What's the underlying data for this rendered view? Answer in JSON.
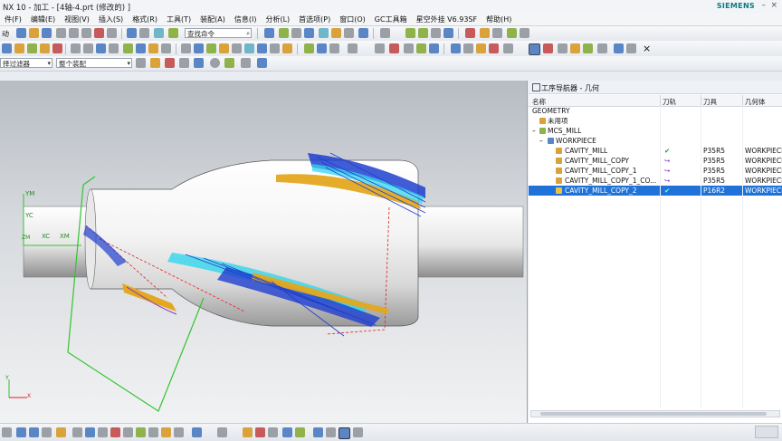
{
  "window": {
    "title": "NX 10 - 加工 - [4轴-4.prt  (修改的)  ]",
    "brand": "SIEMENS"
  },
  "menu": [
    "件(F)",
    "编辑(E)",
    "视图(V)",
    "插入(S)",
    "格式(R)",
    "工具(T)",
    "装配(A)",
    "信息(I)",
    "分析(L)",
    "首选项(P)",
    "窗口(O)",
    "GC工具箱",
    "星空外挂 V6.93SF",
    "帮助(H)"
  ],
  "toolbar": {
    "start_label": "动",
    "command_search_placeholder": "查找命令",
    "selection_filter": "择过滤器",
    "assembly_scope": "整个装配"
  },
  "navigator": {
    "title": "工序导航器 - 几何",
    "columns": [
      "名称",
      "刀轨",
      "刀具",
      "几何体"
    ],
    "tree": [
      {
        "name": "GEOMETRY",
        "toolpath": "",
        "tool": "",
        "geometry": "",
        "selected": false
      },
      {
        "name": "未用项",
        "toolpath": "",
        "tool": "",
        "geometry": "",
        "selected": false
      },
      {
        "name": "MCS_MILL",
        "toolpath": "",
        "tool": "",
        "geometry": "",
        "selected": false
      },
      {
        "name": "WORKPIECE",
        "toolpath": "",
        "tool": "",
        "geometry": "",
        "selected": false
      },
      {
        "name": "CAVITY_MILL",
        "toolpath": "✔",
        "tool": "P35R5",
        "geometry": "WORKPIECE",
        "selected": false
      },
      {
        "name": "CAVITY_MILL_COPY",
        "toolpath": "↪",
        "tool": "P35R5",
        "geometry": "WORKPIECE",
        "selected": false
      },
      {
        "name": "CAVITY_MILL_COPY_1",
        "toolpath": "↪",
        "tool": "P35R5",
        "geometry": "WORKPIECE",
        "selected": false
      },
      {
        "name": "CAVITY_MILL_COPY_1_CO...",
        "toolpath": "↪",
        "tool": "P35R5",
        "geometry": "WORKPIECE",
        "selected": false
      },
      {
        "name": "CAVITY_MILL_COPY_2",
        "toolpath": "✔",
        "tool": "P16R2",
        "geometry": "WORKPIECE",
        "selected": true
      }
    ]
  },
  "axes": {
    "ym": "YM",
    "yc": "YC",
    "xc": "XC",
    "xm": "XM",
    "zm": "ZM",
    "x": "X",
    "y": "Y"
  },
  "colors": {
    "toolpath_cyan": "#33d6ee",
    "toolpath_blue": "#1f3fcf",
    "toolpath_orange": "#e3a81f",
    "mcs_green": "#31c431",
    "selection": "#1f73d8",
    "check_green": "#1e9e3a",
    "warn_purple": "#8a2fd0"
  }
}
